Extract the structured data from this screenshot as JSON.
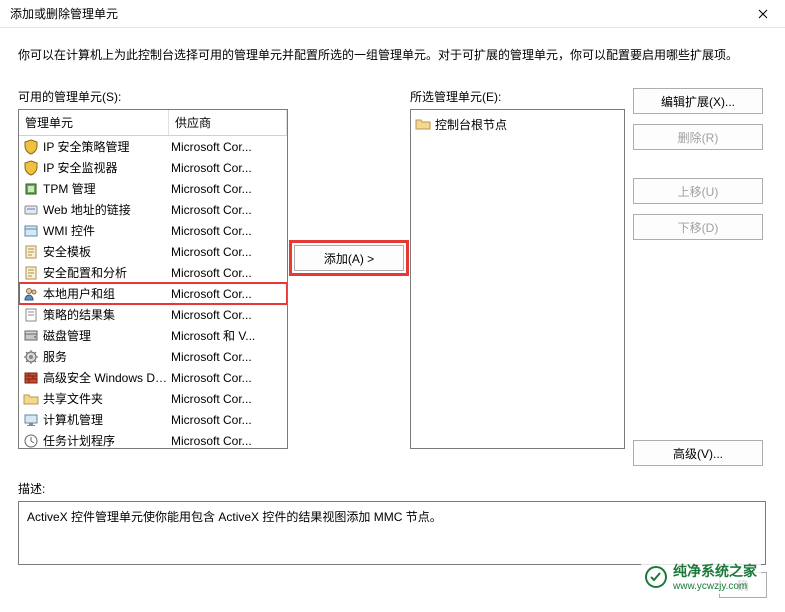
{
  "titlebar": {
    "title": "添加或删除管理单元"
  },
  "intro": "你可以在计算机上为此控制台选择可用的管理单元并配置所选的一组管理单元。对于可扩展的管理单元，你可以配置要启用哪些扩展项。",
  "available": {
    "label": "可用的管理单元(S):",
    "headers": {
      "name": "管理单元",
      "vendor": "供应商"
    },
    "items": [
      {
        "name": "IP 安全策略管理",
        "vendor": "Microsoft Cor...",
        "icon": "shield-key"
      },
      {
        "name": "IP 安全监视器",
        "vendor": "Microsoft Cor...",
        "icon": "shield-key"
      },
      {
        "name": "TPM 管理",
        "vendor": "Microsoft Cor...",
        "icon": "tpm"
      },
      {
        "name": "Web 地址的链接",
        "vendor": "Microsoft Cor...",
        "icon": "link"
      },
      {
        "name": "WMI 控件",
        "vendor": "Microsoft Cor...",
        "icon": "wmi"
      },
      {
        "name": "安全模板",
        "vendor": "Microsoft Cor...",
        "icon": "template"
      },
      {
        "name": "安全配置和分析",
        "vendor": "Microsoft Cor...",
        "icon": "template"
      },
      {
        "name": "本地用户和组",
        "vendor": "Microsoft Cor...",
        "icon": "users",
        "highlight": true
      },
      {
        "name": "策略的结果集",
        "vendor": "Microsoft Cor...",
        "icon": "policy"
      },
      {
        "name": "磁盘管理",
        "vendor": "Microsoft 和 V...",
        "icon": "disk"
      },
      {
        "name": "服务",
        "vendor": "Microsoft Cor...",
        "icon": "gear"
      },
      {
        "name": "高级安全 Windows De...",
        "vendor": "Microsoft Cor...",
        "icon": "firewall"
      },
      {
        "name": "共享文件夹",
        "vendor": "Microsoft Cor...",
        "icon": "folder"
      },
      {
        "name": "计算机管理",
        "vendor": "Microsoft Cor...",
        "icon": "computer"
      },
      {
        "name": "任务计划程序",
        "vendor": "Microsoft Cor...",
        "icon": "task"
      }
    ]
  },
  "add_button": "添加(A) >",
  "selected": {
    "label": "所选管理单元(E):",
    "root": "控制台根节点"
  },
  "side_buttons": {
    "edit_ext": "编辑扩展(X)...",
    "remove": "删除(R)",
    "move_up": "上移(U)",
    "move_down": "下移(D)",
    "advanced": "高级(V)..."
  },
  "description": {
    "label": "描述:",
    "text": "ActiveX 控件管理单元使你能用包含 ActiveX 控件的结果视图添加 MMC 节点。"
  },
  "bottom": {
    "ok_partial": "确"
  },
  "watermark": {
    "brand": "纯净系统之家",
    "url": "www.ycwzjy.com"
  }
}
